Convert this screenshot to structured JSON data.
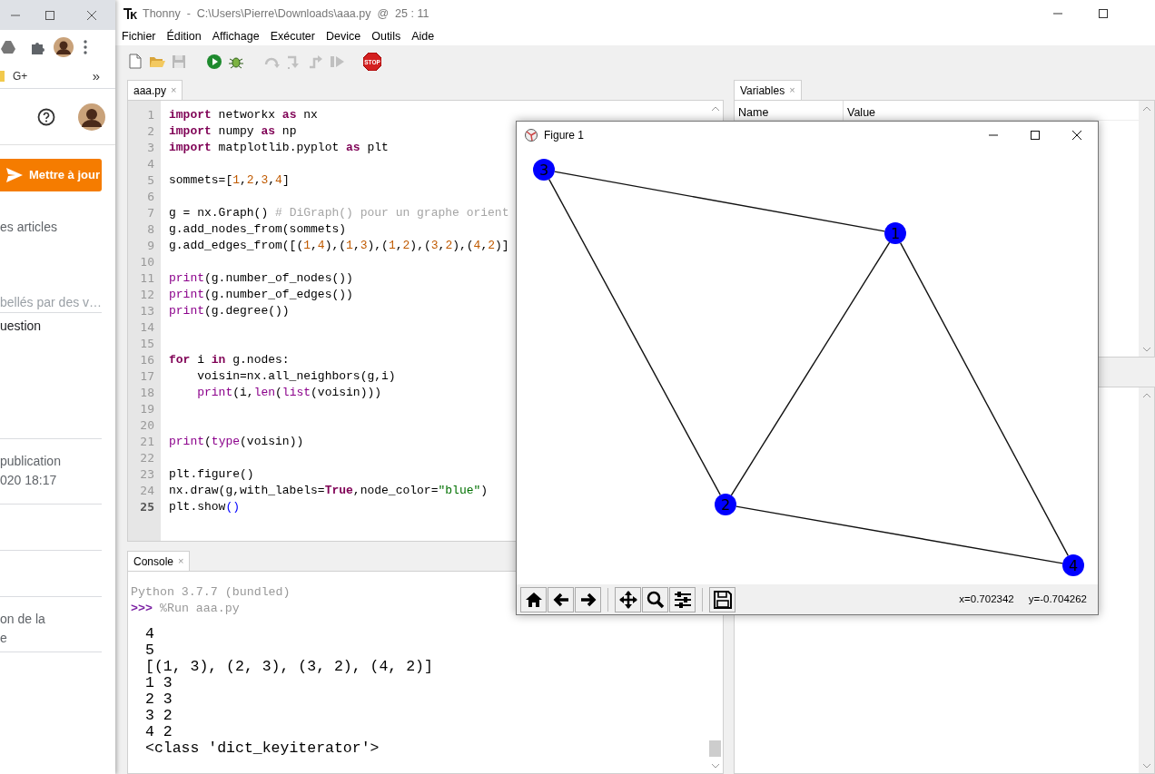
{
  "browser": {
    "bookmarks": [
      "G+"
    ],
    "bookmarks_more": "»",
    "update_button": "Mettre à jour",
    "page_texts": [
      {
        "text": "es articles",
        "kind": "body"
      },
      {
        "text": "bellés par des v…",
        "kind": "hint"
      },
      {
        "text": "uestion",
        "kind": "strong"
      },
      {
        "text": "publication",
        "kind": "body"
      },
      {
        "text": "020 18:17",
        "kind": "body"
      },
      {
        "text": "on de la",
        "kind": "body"
      },
      {
        "text": "e",
        "kind": "body"
      }
    ]
  },
  "thonny": {
    "title": "Thonny  -  C:\\Users\\Pierre\\Downloads\\aaa.py  @  25 : 11",
    "menu": [
      "Fichier",
      "Édition",
      "Affichage",
      "Exécuter",
      "Device",
      "Outils",
      "Aide"
    ],
    "toolbar": [
      {
        "kind": "new",
        "disabled": false
      },
      {
        "kind": "open",
        "disabled": false
      },
      {
        "kind": "save",
        "disabled": true
      },
      {
        "kind": "run",
        "disabled": false
      },
      {
        "kind": "debug",
        "disabled": false
      },
      {
        "kind": "step-over",
        "disabled": true
      },
      {
        "kind": "step-into",
        "disabled": true
      },
      {
        "kind": "step-out",
        "disabled": true
      },
      {
        "kind": "resume",
        "disabled": true
      },
      {
        "kind": "stop",
        "disabled": false,
        "label": "STOP"
      }
    ],
    "editor": {
      "tab": {
        "label": "aaa.py",
        "close": "×"
      },
      "lines": [
        {
          "number": "1",
          "current": false,
          "tokens": [
            {
              "kind": "keyword",
              "text": "import"
            },
            {
              "kind": "plain",
              "text": " networkx "
            },
            {
              "kind": "keyword",
              "text": "as"
            },
            {
              "kind": "plain",
              "text": " nx"
            }
          ]
        },
        {
          "number": "2",
          "current": false,
          "tokens": [
            {
              "kind": "keyword",
              "text": "import"
            },
            {
              "kind": "plain",
              "text": " numpy "
            },
            {
              "kind": "keyword",
              "text": "as"
            },
            {
              "kind": "plain",
              "text": " np"
            }
          ]
        },
        {
          "number": "3",
          "current": false,
          "tokens": [
            {
              "kind": "keyword",
              "text": "import"
            },
            {
              "kind": "plain",
              "text": " matplotlib.pyplot "
            },
            {
              "kind": "keyword",
              "text": "as"
            },
            {
              "kind": "plain",
              "text": " plt"
            }
          ]
        },
        {
          "number": "4",
          "current": false
        },
        {
          "number": "5",
          "current": false,
          "tokens": [
            {
              "kind": "plain",
              "text": "sommets=["
            },
            {
              "kind": "number",
              "text": "1"
            },
            {
              "kind": "plain",
              "text": ","
            },
            {
              "kind": "number",
              "text": "2"
            },
            {
              "kind": "plain",
              "text": ","
            },
            {
              "kind": "number",
              "text": "3"
            },
            {
              "kind": "plain",
              "text": ","
            },
            {
              "kind": "number",
              "text": "4"
            },
            {
              "kind": "plain",
              "text": "]"
            }
          ]
        },
        {
          "number": "6",
          "current": false
        },
        {
          "number": "7",
          "current": false,
          "tokens": [
            {
              "kind": "plain",
              "text": "g = nx.Graph() "
            },
            {
              "kind": "comment",
              "text": "# DiGraph() pour un graphe orient"
            }
          ]
        },
        {
          "number": "8",
          "current": false,
          "tokens": [
            {
              "kind": "plain",
              "text": "g.add_nodes_from(sommets)"
            }
          ]
        },
        {
          "number": "9",
          "current": false,
          "tokens": [
            {
              "kind": "plain",
              "text": "g.add_edges_from([("
            },
            {
              "kind": "number",
              "text": "1"
            },
            {
              "kind": "plain",
              "text": ","
            },
            {
              "kind": "number",
              "text": "4"
            },
            {
              "kind": "plain",
              "text": "),("
            },
            {
              "kind": "number",
              "text": "1"
            },
            {
              "kind": "plain",
              "text": ","
            },
            {
              "kind": "number",
              "text": "3"
            },
            {
              "kind": "plain",
              "text": "),("
            },
            {
              "kind": "number",
              "text": "1"
            },
            {
              "kind": "plain",
              "text": ","
            },
            {
              "kind": "number",
              "text": "2"
            },
            {
              "kind": "plain",
              "text": "),("
            },
            {
              "kind": "number",
              "text": "3"
            },
            {
              "kind": "plain",
              "text": ","
            },
            {
              "kind": "number",
              "text": "2"
            },
            {
              "kind": "plain",
              "text": "),("
            },
            {
              "kind": "number",
              "text": "4"
            },
            {
              "kind": "plain",
              "text": ","
            },
            {
              "kind": "number",
              "text": "2"
            },
            {
              "kind": "plain",
              "text": ")]"
            }
          ]
        },
        {
          "number": "10",
          "current": false
        },
        {
          "number": "11",
          "current": false,
          "tokens": [
            {
              "kind": "builtin",
              "text": "print"
            },
            {
              "kind": "plain",
              "text": "(g.number_of_nodes())"
            }
          ]
        },
        {
          "number": "12",
          "current": false,
          "tokens": [
            {
              "kind": "builtin",
              "text": "print"
            },
            {
              "kind": "plain",
              "text": "(g.number_of_edges())"
            }
          ]
        },
        {
          "number": "13",
          "current": false,
          "tokens": [
            {
              "kind": "builtin",
              "text": "print"
            },
            {
              "kind": "plain",
              "text": "(g.degree())"
            }
          ]
        },
        {
          "number": "14",
          "current": false
        },
        {
          "number": "15",
          "current": false
        },
        {
          "number": "16",
          "current": false,
          "tokens": [
            {
              "kind": "keyword",
              "text": "for"
            },
            {
              "kind": "plain",
              "text": " i "
            },
            {
              "kind": "keyword",
              "text": "in"
            },
            {
              "kind": "plain",
              "text": " g.nodes:"
            }
          ],
          "children": [
            {
              "number": "17",
              "current": false,
              "tokens": [
                {
                  "kind": "plain",
                  "text": "voisin=nx.all_neighbors(g,i)"
                }
              ]
            },
            {
              "number": "18",
              "current": false,
              "tokens": [
                {
                  "kind": "builtin",
                  "text": "print"
                },
                {
                  "kind": "plain",
                  "text": "(i,"
                },
                {
                  "kind": "builtin",
                  "text": "len"
                },
                {
                  "kind": "plain",
                  "text": "("
                },
                {
                  "kind": "builtin",
                  "text": "list"
                },
                {
                  "kind": "plain",
                  "text": "(voisin)))"
                }
              ]
            }
          ]
        },
        {
          "number": "19",
          "current": false
        },
        {
          "number": "20",
          "current": false
        },
        {
          "number": "21",
          "current": false,
          "tokens": [
            {
              "kind": "builtin",
              "text": "print"
            },
            {
              "kind": "plain",
              "text": "("
            },
            {
              "kind": "builtin",
              "text": "type"
            },
            {
              "kind": "plain",
              "text": "(voisin))"
            }
          ]
        },
        {
          "number": "22",
          "current": false
        },
        {
          "number": "23",
          "current": false,
          "tokens": [
            {
              "kind": "plain",
              "text": "plt.figure()"
            }
          ]
        },
        {
          "number": "24",
          "current": false,
          "tokens": [
            {
              "kind": "plain",
              "text": "nx.draw(g,with_labels="
            },
            {
              "kind": "keyword",
              "text": "True"
            },
            {
              "kind": "plain",
              "text": ",node_color="
            },
            {
              "kind": "string",
              "text": "\"blue\""
            },
            {
              "kind": "plain",
              "text": ")"
            }
          ]
        },
        {
          "number": "25",
          "current": true,
          "tokens": [
            {
              "kind": "plain",
              "text": "plt.show"
            },
            {
              "kind": "bracket",
              "text": "()"
            }
          ]
        }
      ]
    },
    "console": {
      "tab": {
        "label": "Console",
        "close": "×"
      },
      "banner": "Python 3.7.7 (bundled)",
      "prompt": ">>>",
      "command": "%Run aaa.py",
      "output": [
        "4",
        "5",
        "[(1, 3), (2, 3), (3, 2), (4, 2)]",
        "1 3",
        "2 3",
        "3 2",
        "4 2",
        "<class 'dict_keyiterator'>"
      ]
    },
    "variables": {
      "tab": {
        "label": "Variables",
        "close": "×"
      },
      "columns": [
        "Name",
        "Value"
      ]
    }
  },
  "figure": {
    "title": "Figure 1",
    "nodes": [
      {
        "label": "3"
      },
      {
        "label": "1"
      },
      {
        "label": "2"
      },
      {
        "label": "4"
      }
    ],
    "toolbar": [
      {
        "kind": "home"
      },
      {
        "kind": "back"
      },
      {
        "kind": "forward"
      },
      {
        "kind": "pan"
      },
      {
        "kind": "zoom"
      },
      {
        "kind": "configure"
      },
      {
        "kind": "save"
      }
    ],
    "coordinates": [
      "x=0.702342",
      "y=-0.704262"
    ]
  }
}
